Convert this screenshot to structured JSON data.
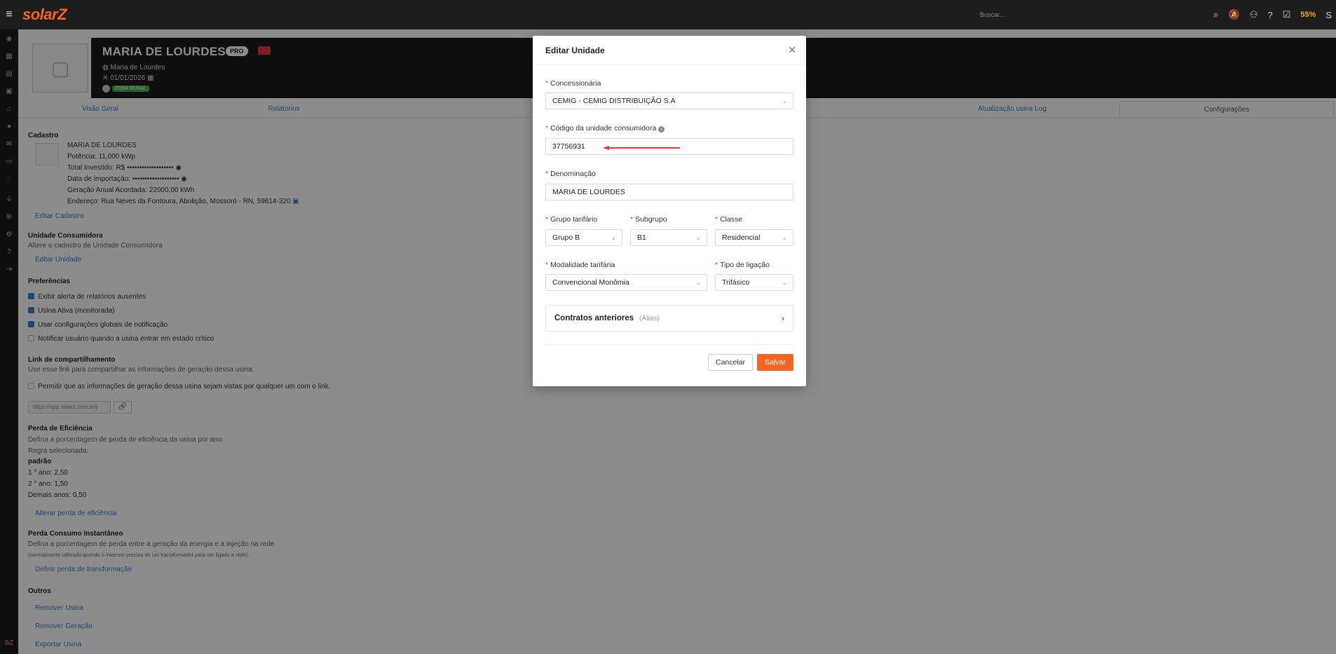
{
  "topbar": {
    "brand": "solarZ",
    "search_placeholder": "Buscar...",
    "battery_label": "55%"
  },
  "header": {
    "title": "MARIA DE LOURDES",
    "badge": "PRO",
    "owner": "Maria de Lourdes",
    "date": "01/01/2026",
    "zone": "ZONA RURAL"
  },
  "tabs": [
    {
      "label": "Visão Geral"
    },
    {
      "label": "Relatórios"
    },
    {
      "label": "Atualização usina Log"
    },
    {
      "label": "Configurações"
    }
  ],
  "content": {
    "cadastro_title": "Cadastro",
    "name": "MARIA DE LOURDES",
    "potencia": "Potência: 11,000 kWp",
    "total_investido": "Total Investido: R$ •••••••••••••••••••",
    "data_importacao": "Data de importação: •••••••••••••••••••",
    "geracao": "Geração Anual Acordada: 22000,00 kWh",
    "endereco": "Endereço: Rua Neves da Fontoura, Abolição, Mossoró - RN, 59614-320",
    "editar_cadastro": "Editar Cadastro",
    "uc_title": "Unidade Consumidora",
    "uc_desc": "Altere o cadastro da Unidade Consumidora",
    "editar_unidade": "Editar Unidade",
    "pref_title": "Preferências",
    "pref1": "Exibir alerta de relatórios ausentes",
    "pref2": "Usina Ativa (monitorada)",
    "pref3": "Usar configurações globais de notificação",
    "pref4": "Notificar usuário quando a usina entrar em estado crítico",
    "link_title": "Link de compartilhamento",
    "link_desc": "Use esse link para compartilhar as informações de geração dessa usina.",
    "link_chk": "Permitir que as informações de geração dessa usina sejam vistas por qualquer um com o link.",
    "link_value": "https://app.solarz.com.br/j",
    "perda_title": "Perda de Eficiência",
    "perda_desc": "Defina a porcentagem de perda de eficiência da usina por ano.",
    "regra": "Regra selecionada:",
    "padrao": "padrão",
    "ano1": "1 ° ano: 2,50",
    "ano2": "2 ° ano: 1,50",
    "demais": "Demais anos: 0,50",
    "alterar_perda": "Alterar perda de eficiência",
    "consumo_title": "Perda Consumo Instantâneo",
    "consumo_desc": "Defina a porcentagem de perda entre a geração da energia e a injeção na rede",
    "consumo_note": "(normalmente utilizado quando o inversor precisa de um transformador para ser ligado a rede).",
    "definir_perda": "Definir perda de transformação",
    "outros_title": "Outros",
    "remover_usina": "Remover Usina",
    "remover_geracao": "Remover Geração",
    "exportar_usina": "Exportar Usina"
  },
  "modal": {
    "title": "Editar Unidade",
    "concessionaria_label": "Concessionária",
    "concessionaria_value": "CEMIG - CEMIG DISTRIBUIÇÃO S.A",
    "codigo_label": "Código da unidade consumidora",
    "codigo_value": "37756931",
    "denominacao_label": "Denominação",
    "denominacao_value": "MARIA DE LOURDES",
    "grupo_label": "Grupo tarifário",
    "grupo_value": "Grupo B",
    "subgrupo_label": "Subgrupo",
    "subgrupo_value": "B1",
    "classe_label": "Classe",
    "classe_value": "Residencial",
    "modalidade_label": "Modalidade tarifária",
    "modalidade_value": "Convencional Monômia",
    "ligacao_label": "Tipo de ligação",
    "ligacao_value": "Trifásico",
    "contratos_label": "Contratos anteriores",
    "contratos_sub": "(Alias)",
    "cancel": "Cancelar",
    "save": "Salvar"
  },
  "colors": {
    "accent": "#f26522",
    "link": "#3a7bd5",
    "required": "#e53935",
    "annotation_arrow": "#e53935"
  }
}
